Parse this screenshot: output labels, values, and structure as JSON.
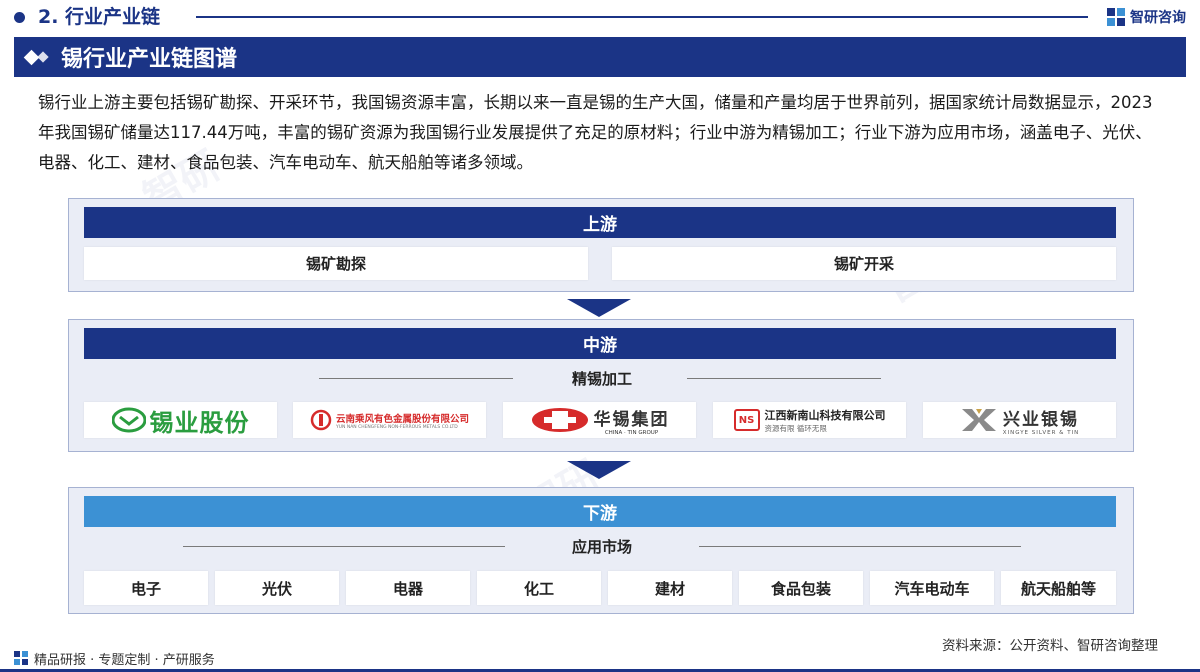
{
  "header": {
    "section_title": "2. 行业产业链",
    "brand": "智研咨询"
  },
  "title_bar": {
    "title": "锡行业产业链图谱"
  },
  "intro": "锡行业上游主要包括锡矿勘探、开采环节，我国锡资源丰富，长期以来一直是锡的生产大国，储量和产量均居于世界前列，据国家统计局数据显示，2023年我国锡矿储量达117.44万吨，丰富的锡矿资源为我国锡行业发展提供了充足的原材料；行业中游为精锡加工；行业下游为应用市场，涵盖电子、光伏、电器、化工、建材、食品包装、汽车电动车、航天船舶等诸多领域。",
  "upstream": {
    "label": "上游",
    "items": [
      "锡矿勘探",
      "锡矿开采"
    ]
  },
  "midstream": {
    "label": "中游",
    "sub_label": "精锡加工",
    "companies": [
      {
        "name": "锡业股份"
      },
      {
        "name": "云南乘风有色金属股份有限公司",
        "sub": "YUN NAN CHENGFENG NON-FERROUS METALS CO.LTD"
      },
      {
        "name": "华锡集团",
        "sub": "CHINA · TIN GROUP"
      },
      {
        "name": "江西新南山科技有限公司",
        "sub": "资源有限  循环无限",
        "mark": "NS"
      },
      {
        "name": "兴业银锡",
        "sub": "XINGYE SILVER & TIN"
      }
    ]
  },
  "downstream": {
    "label": "下游",
    "sub_label": "应用市场",
    "items": [
      "电子",
      "光伏",
      "电器",
      "化工",
      "建材",
      "食品包装",
      "汽车电动车",
      "航天船舶等"
    ]
  },
  "footer": {
    "slogan": "精品研报 · 专题定制 · 产研服务",
    "source": "资料来源：公开资料、智研咨询整理"
  },
  "colors": {
    "primary": "#1b3486",
    "accent": "#3c91d4",
    "panel_bg": "#eaedf6",
    "logo_green": "#2a9d3f",
    "logo_red": "#d62b2b"
  }
}
